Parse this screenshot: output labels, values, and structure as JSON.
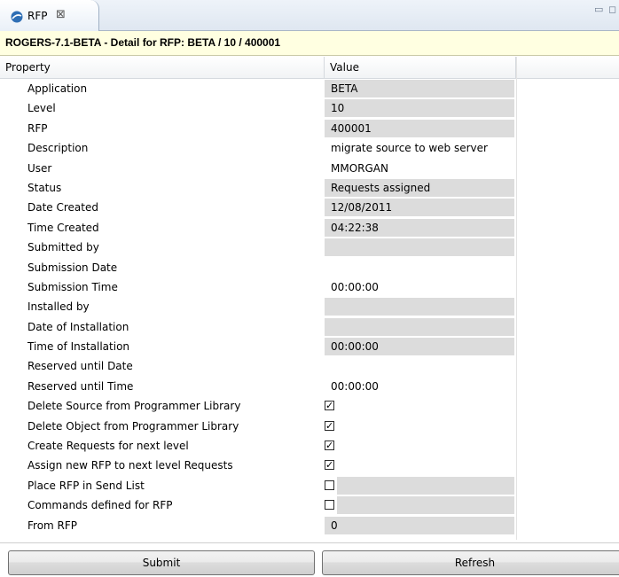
{
  "tab": {
    "title": "RFP",
    "close_glyph": "⊠",
    "icon": "rfp-globe-icon"
  },
  "window_controls": {
    "minimize_glyph": "▭",
    "maximize_glyph": "◻"
  },
  "header": {
    "title": "ROGERS-7.1-BETA - Detail for RFP: BETA / 10 / 400001"
  },
  "columns": {
    "property": "Property",
    "value": "Value"
  },
  "rows": [
    {
      "label": "Application",
      "value": "BETA",
      "shaded": true
    },
    {
      "label": "Level",
      "value": "10",
      "shaded": true
    },
    {
      "label": "RFP",
      "value": "400001",
      "shaded": true
    },
    {
      "label": "Description",
      "value": "migrate source to web server",
      "shaded": false
    },
    {
      "label": "User",
      "value": "MMORGAN",
      "shaded": false
    },
    {
      "label": "Status",
      "value": "Requests assigned",
      "shaded": true
    },
    {
      "label": "Date Created",
      "value": "12/08/2011",
      "shaded": true
    },
    {
      "label": "Time Created",
      "value": "04:22:38",
      "shaded": true
    },
    {
      "label": "Submitted by",
      "value": "",
      "shaded": true
    },
    {
      "label": "Submission Date",
      "value": "",
      "shaded": false
    },
    {
      "label": "Submission Time",
      "value": "00:00:00",
      "shaded": false
    },
    {
      "label": "Installed by",
      "value": "",
      "shaded": true
    },
    {
      "label": "Date of Installation",
      "value": "",
      "shaded": true
    },
    {
      "label": "Time of Installation",
      "value": "00:00:00",
      "shaded": true
    },
    {
      "label": "Reserved until Date",
      "value": "",
      "shaded": false
    },
    {
      "label": "Reserved until Time",
      "value": "00:00:00",
      "shaded": false
    },
    {
      "label": "Delete Source from Programmer Library",
      "checkbox": true,
      "checked": true
    },
    {
      "label": "Delete Object from Programmer Library",
      "checkbox": true,
      "checked": true
    },
    {
      "label": "Create Requests for next level",
      "checkbox": true,
      "checked": true
    },
    {
      "label": "Assign new RFP to next level Requests",
      "checkbox": true,
      "checked": true
    },
    {
      "label": "Place RFP in Send List",
      "checkbox": true,
      "checked": false,
      "shaded": true
    },
    {
      "label": "Commands defined for RFP",
      "checkbox": true,
      "checked": false,
      "shaded": true
    },
    {
      "label": "From RFP",
      "value": "0",
      "shaded": true
    }
  ],
  "buttons": {
    "submit": "Submit",
    "refresh": "Refresh"
  },
  "colors": {
    "header_bg": "#ffffe1",
    "readonly_cell": "#dcdcdc",
    "tab_accent": "#2f6fb5"
  }
}
